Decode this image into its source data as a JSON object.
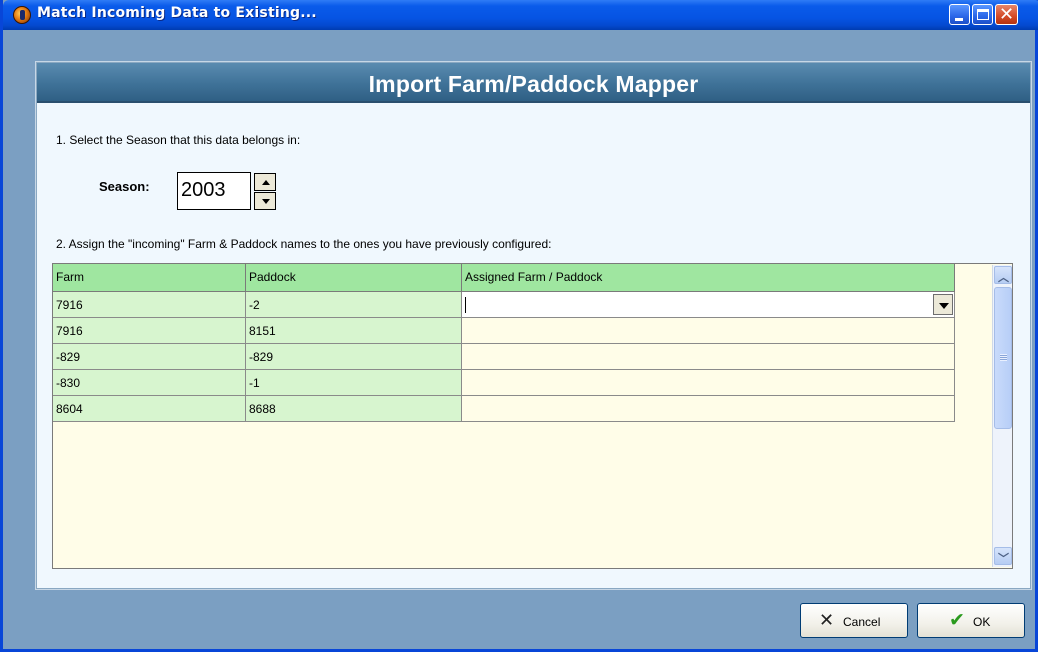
{
  "window": {
    "title": "Match Incoming Data to Existing..."
  },
  "banner": {
    "title": "Import Farm/Paddock Mapper"
  },
  "step1": {
    "text": "1. Select the Season that this data belongs in:"
  },
  "season": {
    "label": "Season:",
    "value": "2003"
  },
  "step2": {
    "text": "2. Assign the \"incoming\" Farm & Paddock names to the ones you have previously configured:"
  },
  "grid": {
    "columns": [
      "Farm",
      "Paddock",
      "Assigned Farm / Paddock"
    ],
    "rows": [
      {
        "farm": "7916",
        "paddock": "-2",
        "assigned": ""
      },
      {
        "farm": "7916",
        "paddock": "8151",
        "assigned": ""
      },
      {
        "farm": "-829",
        "paddock": "-829",
        "assigned": ""
      },
      {
        "farm": "-830",
        "paddock": "-1",
        "assigned": ""
      },
      {
        "farm": "8604",
        "paddock": "8688",
        "assigned": ""
      }
    ]
  },
  "buttons": {
    "cancel": "Cancel",
    "ok": "OK"
  },
  "colors": {
    "header_green": "#9fe6a0",
    "key_cell_green": "#d7f5cf",
    "banner_blue": "#3f7298",
    "titlebar_blue": "#0654e3"
  }
}
